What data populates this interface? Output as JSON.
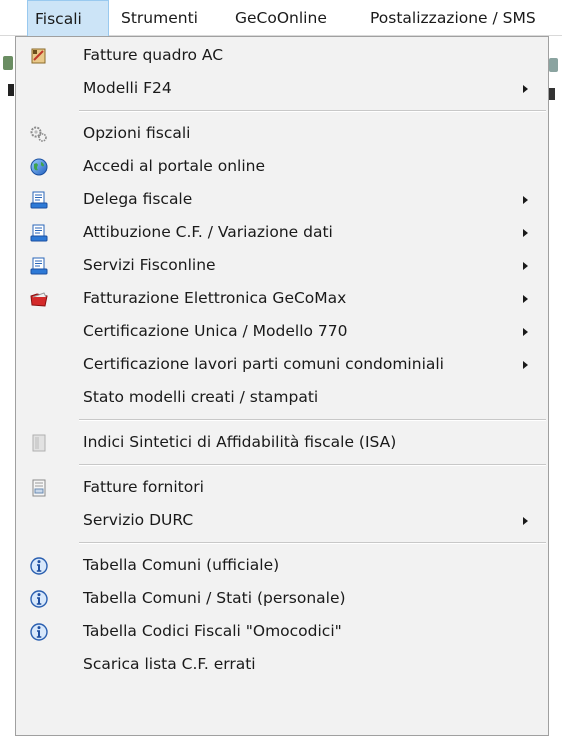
{
  "menubar": {
    "items": [
      "Fiscali",
      "Strumenti",
      "GeCoOnline",
      "Postalizzazione / SMS"
    ]
  },
  "menu": {
    "groups": [
      [
        {
          "label": "Fatture quadro AC",
          "icon": "invoice-ac-icon",
          "submenu": false
        },
        {
          "label": "Modelli F24",
          "icon": "",
          "submenu": true
        }
      ],
      [
        {
          "label": "Opzioni fiscali",
          "icon": "gears-icon",
          "submenu": false
        },
        {
          "label": "Accedi al portale online",
          "icon": "globe-icon",
          "submenu": false
        },
        {
          "label": "Delega fiscale",
          "icon": "document-stack-icon",
          "submenu": true
        },
        {
          "label": "Attibuzione C.F.  / Variazione dati",
          "icon": "document-stack-icon",
          "submenu": true
        },
        {
          "label": "Servizi Fisconline",
          "icon": "document-stack-icon",
          "submenu": true
        },
        {
          "label": "Fatturazione Elettronica GeCoMax",
          "icon": "red-folder-icon",
          "submenu": true
        },
        {
          "label": "Certificazione Unica / Modello 770",
          "icon": "",
          "submenu": true
        },
        {
          "label": "Certificazione lavori parti comuni condominiali",
          "icon": "",
          "submenu": true
        },
        {
          "label": "Stato modelli creati / stampati",
          "icon": "",
          "submenu": false
        }
      ],
      [
        {
          "label": "Indici Sintetici di Affidabilità fiscale (ISA)",
          "icon": "isa-document-icon",
          "submenu": false
        }
      ],
      [
        {
          "label": "Fatture fornitori",
          "icon": "supplier-invoice-icon",
          "submenu": false
        },
        {
          "label": "Servizio DURC",
          "icon": "",
          "submenu": true
        }
      ],
      [
        {
          "label": "Tabella Comuni (ufficiale)",
          "icon": "info-icon",
          "submenu": false
        },
        {
          "label": "Tabella Comuni / Stati (personale)",
          "icon": "info-icon",
          "submenu": false
        },
        {
          "label": "Tabella Codici Fiscali \"Omocodici\"",
          "icon": "info-icon",
          "submenu": false
        },
        {
          "label": "Scarica lista C.F. errati",
          "icon": "",
          "submenu": false
        }
      ]
    ]
  }
}
